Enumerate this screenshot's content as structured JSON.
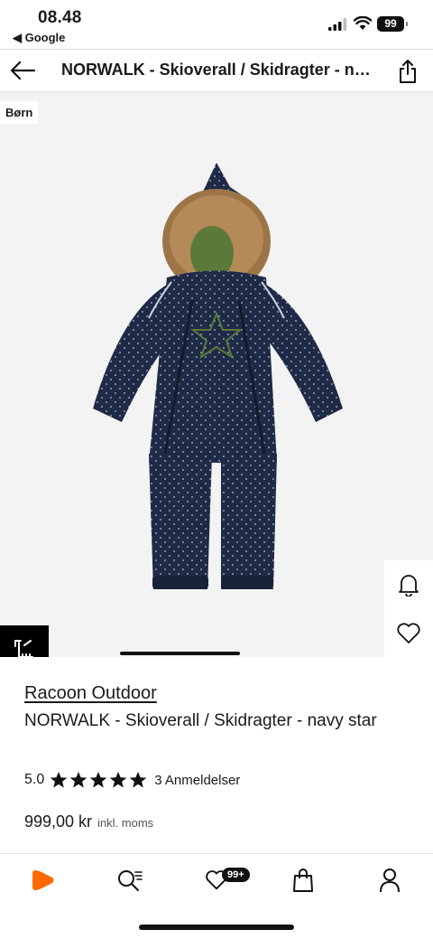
{
  "status_bar": {
    "time": "08.48",
    "back_app": "◀ Google",
    "battery": "99"
  },
  "header": {
    "title": "NORWALK - Skioverall / Skidragter - navy star"
  },
  "gallery": {
    "tag": "Børn"
  },
  "product": {
    "brand": "Racoon Outdoor",
    "name": "NORWALK - Skioverall / Skidragter - navy star",
    "rating": "5.0",
    "stars": 5,
    "reviews": "3 Anmeldelser",
    "price": "999,00 kr",
    "vat_note": "inkl. moms"
  },
  "tabbar": {
    "wishlist_badge": "99+"
  },
  "colors": {
    "accent": "#ff6900",
    "navy": "#1f2a47"
  }
}
